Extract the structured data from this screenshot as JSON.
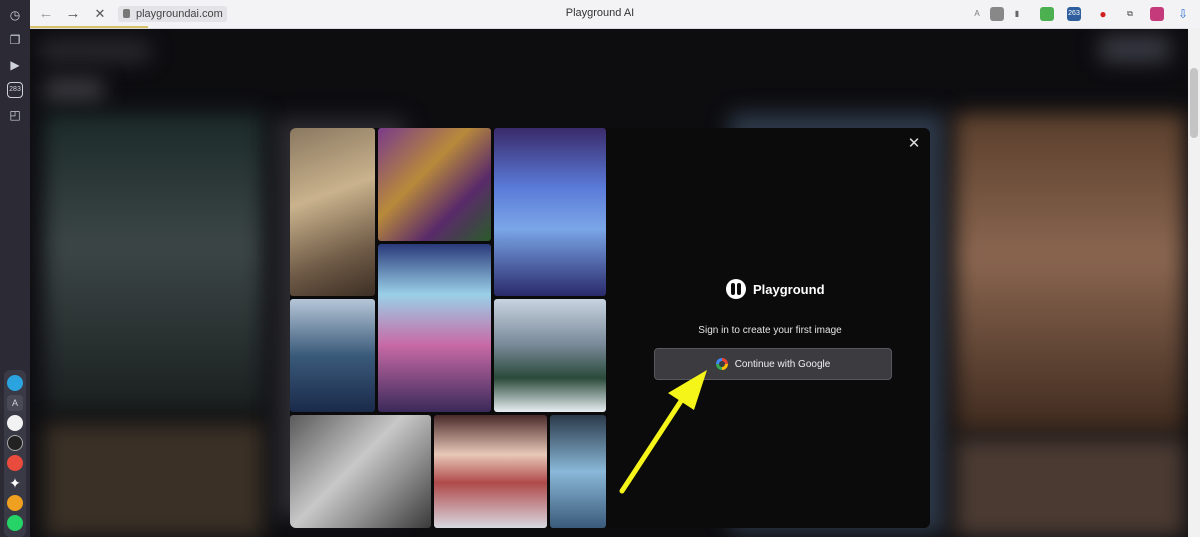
{
  "browser": {
    "url": "playgroundai.com",
    "tab_title": "Playground AI",
    "back_icon": "back-arrow-icon",
    "forward_icon": "forward-arrow-icon",
    "stop_icon": "stop-loading-icon",
    "extension_badge": "263"
  },
  "sidebar": {
    "badge": "283",
    "dock_letter": "A"
  },
  "modal": {
    "brand": "Playground",
    "subtitle": "Sign in to create your first image",
    "google_button": "Continue with Google",
    "close_icon": "close-icon"
  },
  "colors": {
    "modal_bg": "#0b0b0c",
    "button_bg": "#3b3b40",
    "arrow": "#f5f51a"
  }
}
